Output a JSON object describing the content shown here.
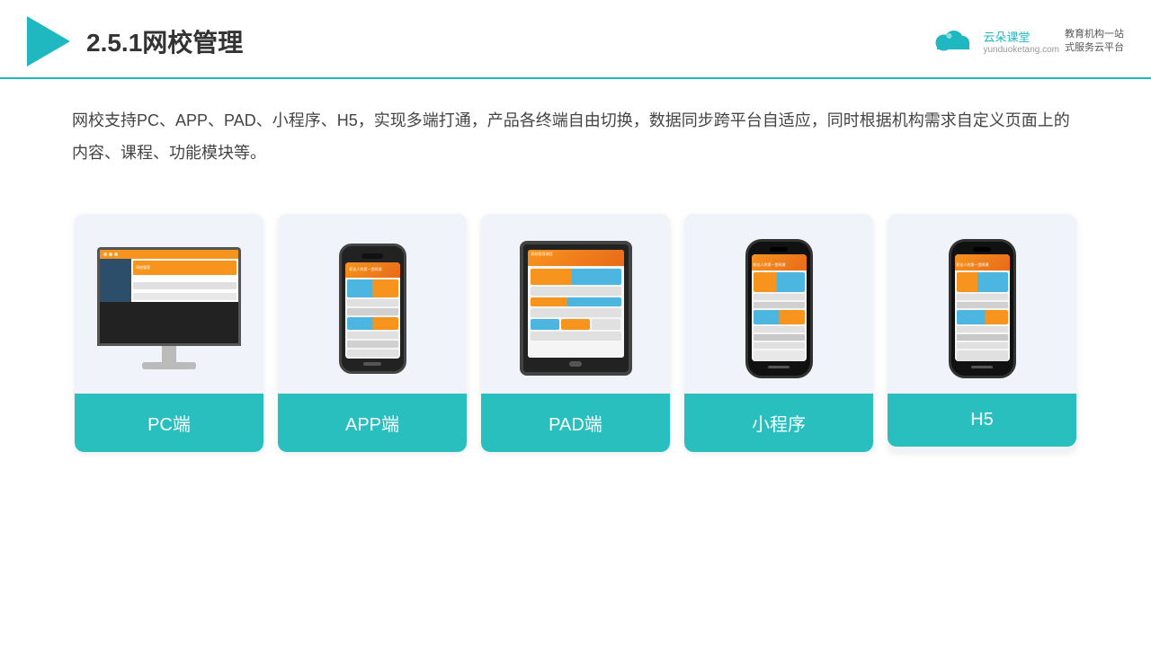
{
  "header": {
    "title": "2.5.1网校管理",
    "brand": {
      "name": "云朵课堂",
      "url": "yunduoketang.com",
      "slogan": "教育机构一站\n式服务云平台"
    }
  },
  "description": "网校支持PC、APP、PAD、小程序、H5，实现多端打通，产品各终端自由切换，数据同步跨平台自适应，同时根据机构需求自定义页面上的内容、课程、功能模块等。",
  "cards": [
    {
      "id": "pc",
      "label": "PC端"
    },
    {
      "id": "app",
      "label": "APP端"
    },
    {
      "id": "pad",
      "label": "PAD端"
    },
    {
      "id": "miniapp",
      "label": "小程序"
    },
    {
      "id": "h5",
      "label": "H5"
    }
  ],
  "colors": {
    "accent": "#2abfbf",
    "header_line": "#1fb8c1",
    "card_bg": "#f0f4fa",
    "label_bg": "#2abfbf",
    "label_text": "#ffffff"
  }
}
